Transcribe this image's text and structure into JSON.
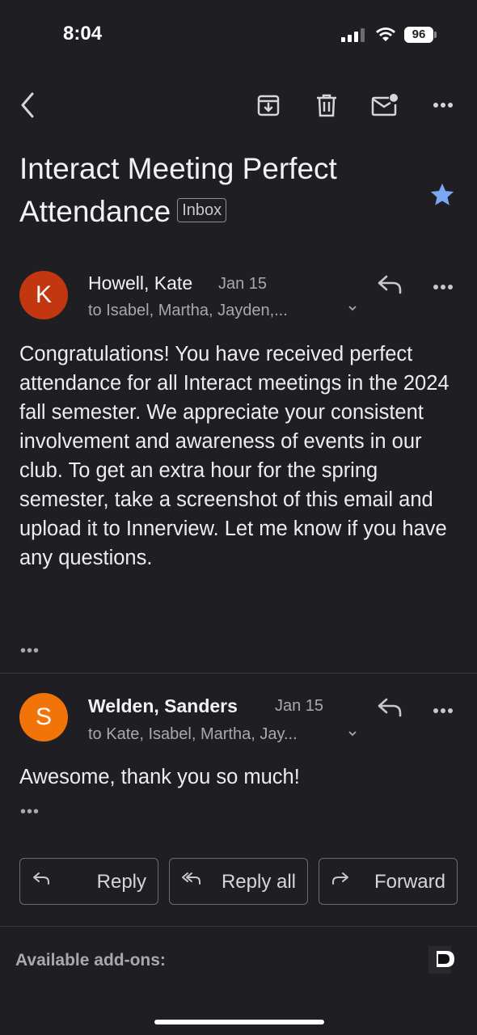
{
  "status_bar": {
    "time": "8:04",
    "battery": "96"
  },
  "toolbar": {
    "back": "back-arrow-icon",
    "archive": "archive-icon",
    "delete": "trash-icon",
    "mark_unread": "mark-unread-icon",
    "more": "more-icon"
  },
  "subject": {
    "title": "Interact Meeting Perfect Attendance",
    "label": "Inbox",
    "starred": true
  },
  "messages": [
    {
      "avatar_letter": "K",
      "avatar_color": "#c2370f",
      "sender": "Howell, Kate",
      "date": "Jan 15",
      "to": "to Isabel, Martha, Jayden,...",
      "body": "Congratulations! You have received perfect attendance for all Interact meetings in the 2024 fall semester. We appreciate your consistent involvement and awareness of events in our club. To get an extra hour for the spring semester, take a screenshot of this email and upload it to Innerview. Let me know if you have any questions.",
      "trimmed": "•••"
    },
    {
      "avatar_letter": "S",
      "avatar_color": "#f27408",
      "sender": "Welden, Sanders",
      "date": "Jan 15",
      "to": "to Kate, Isabel, Martha, Jay...",
      "body": "Awesome, thank you so much!",
      "trimmed": "•••"
    }
  ],
  "actions": {
    "reply": "Reply",
    "reply_all": "Reply all",
    "forward": "Forward"
  },
  "footer": {
    "addons_label": "Available add-ons:"
  },
  "colors": {
    "background": "#1f1f23",
    "star": "#7ba7f5"
  }
}
